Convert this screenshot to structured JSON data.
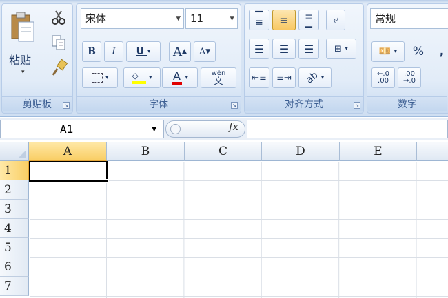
{
  "ribbon": {
    "clipboard": {
      "label": "剪贴板",
      "paste": "粘贴"
    },
    "font": {
      "label": "字体",
      "font_name": "宋体",
      "font_size": "11",
      "bold": "B",
      "italic": "I",
      "underline": "U",
      "grow": "A",
      "shrink": "A",
      "font_color_letter": "A",
      "wen": "wén",
      "wen_char": "文"
    },
    "alignment": {
      "label": "对齐方式"
    },
    "number": {
      "label": "数字",
      "format": "常规",
      "percent": "%",
      "comma": ","
    }
  },
  "formula_bar": {
    "name_box": "A1",
    "fx": "fx",
    "formula": ""
  },
  "sheet": {
    "columns": [
      "A",
      "B",
      "C",
      "D",
      "E"
    ],
    "rows": [
      "1",
      "2",
      "3",
      "4",
      "5",
      "6",
      "7"
    ],
    "active_cell": "A1"
  },
  "colors": {
    "accent": "#f9cf66",
    "ribbon": "#dfe9f6",
    "group_label": "#3d5f93"
  }
}
